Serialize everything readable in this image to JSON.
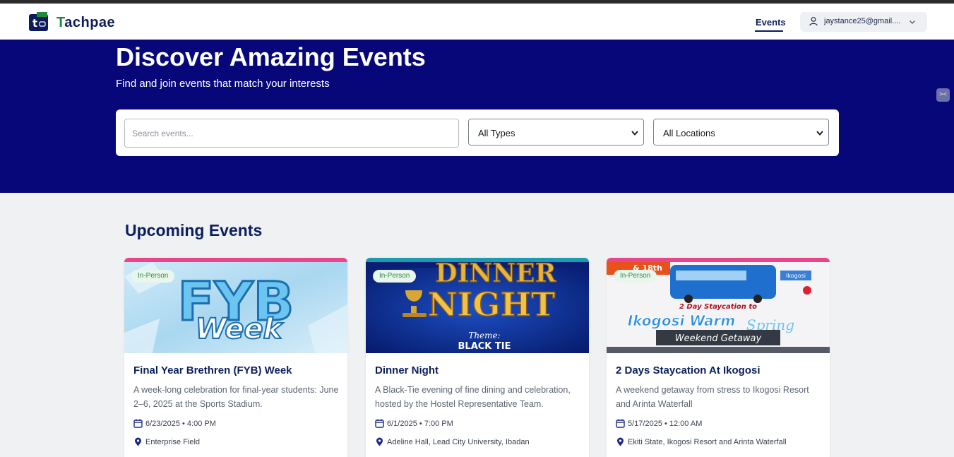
{
  "brand": {
    "name": "Tachpae",
    "name_first": "T",
    "name_rest": "achpae"
  },
  "nav": {
    "events_label": "Events",
    "user_email": "jaystance25@gmail...."
  },
  "hero": {
    "title": "Discover Amazing Events",
    "subtitle": "Find and join events that match your interests",
    "search_placeholder": "Search events...",
    "type_filter": {
      "selected": "All Types"
    },
    "location_filter": {
      "selected": "All Locations"
    }
  },
  "section": {
    "title": "Upcoming Events"
  },
  "events": [
    {
      "badge": "In-Person",
      "title": "Final Year Brethren (FYB) Week",
      "description": "A week-long celebration for final-year students: June 2–6, 2025 at the Sports Stadium.",
      "datetime": "6/23/2025 • 4:00 PM",
      "location": "Enterprise Field",
      "accent": "#e8468c",
      "image_text": [
        "FYB",
        "Week"
      ]
    },
    {
      "badge": "In-Person",
      "title": "Dinner Night",
      "description": "A Black-Tie evening of fine dining and celebration, hosted by the Hostel Representative Team.",
      "datetime": "6/1/2025 • 7:00 PM",
      "location": "Adeline Hall, Lead City University, Ibadan",
      "accent": "#1a9bb0",
      "image_text": [
        "DINNER",
        "NIGHT",
        "Theme:",
        "BLACK TIE"
      ]
    },
    {
      "badge": "In-Person",
      "title": "2 Days Staycation At Ikogosi",
      "description": "A weekend getaway from stress to Ikogosi Resort and Arinta Waterfall",
      "datetime": "5/17/2025 • 12:00 AM",
      "location": "Ekiti State, Ikogosi Resort and Arinta Waterfall",
      "accent": "#e8468c",
      "image_text": [
        "& 18th",
        "Ikogosi",
        "2 Day Staycation to",
        "Ikogosi Warm",
        "Spring",
        "Weekend Getaway"
      ]
    }
  ],
  "colors": {
    "hero_bg": "#07077a",
    "title": "#0b1f5c",
    "badge_bg": "#e9f6ec",
    "badge_text": "#2e8a47"
  },
  "icons": [
    "logo-icon",
    "user-icon",
    "chevron-down-icon",
    "calendar-icon",
    "map-pin-icon"
  ]
}
